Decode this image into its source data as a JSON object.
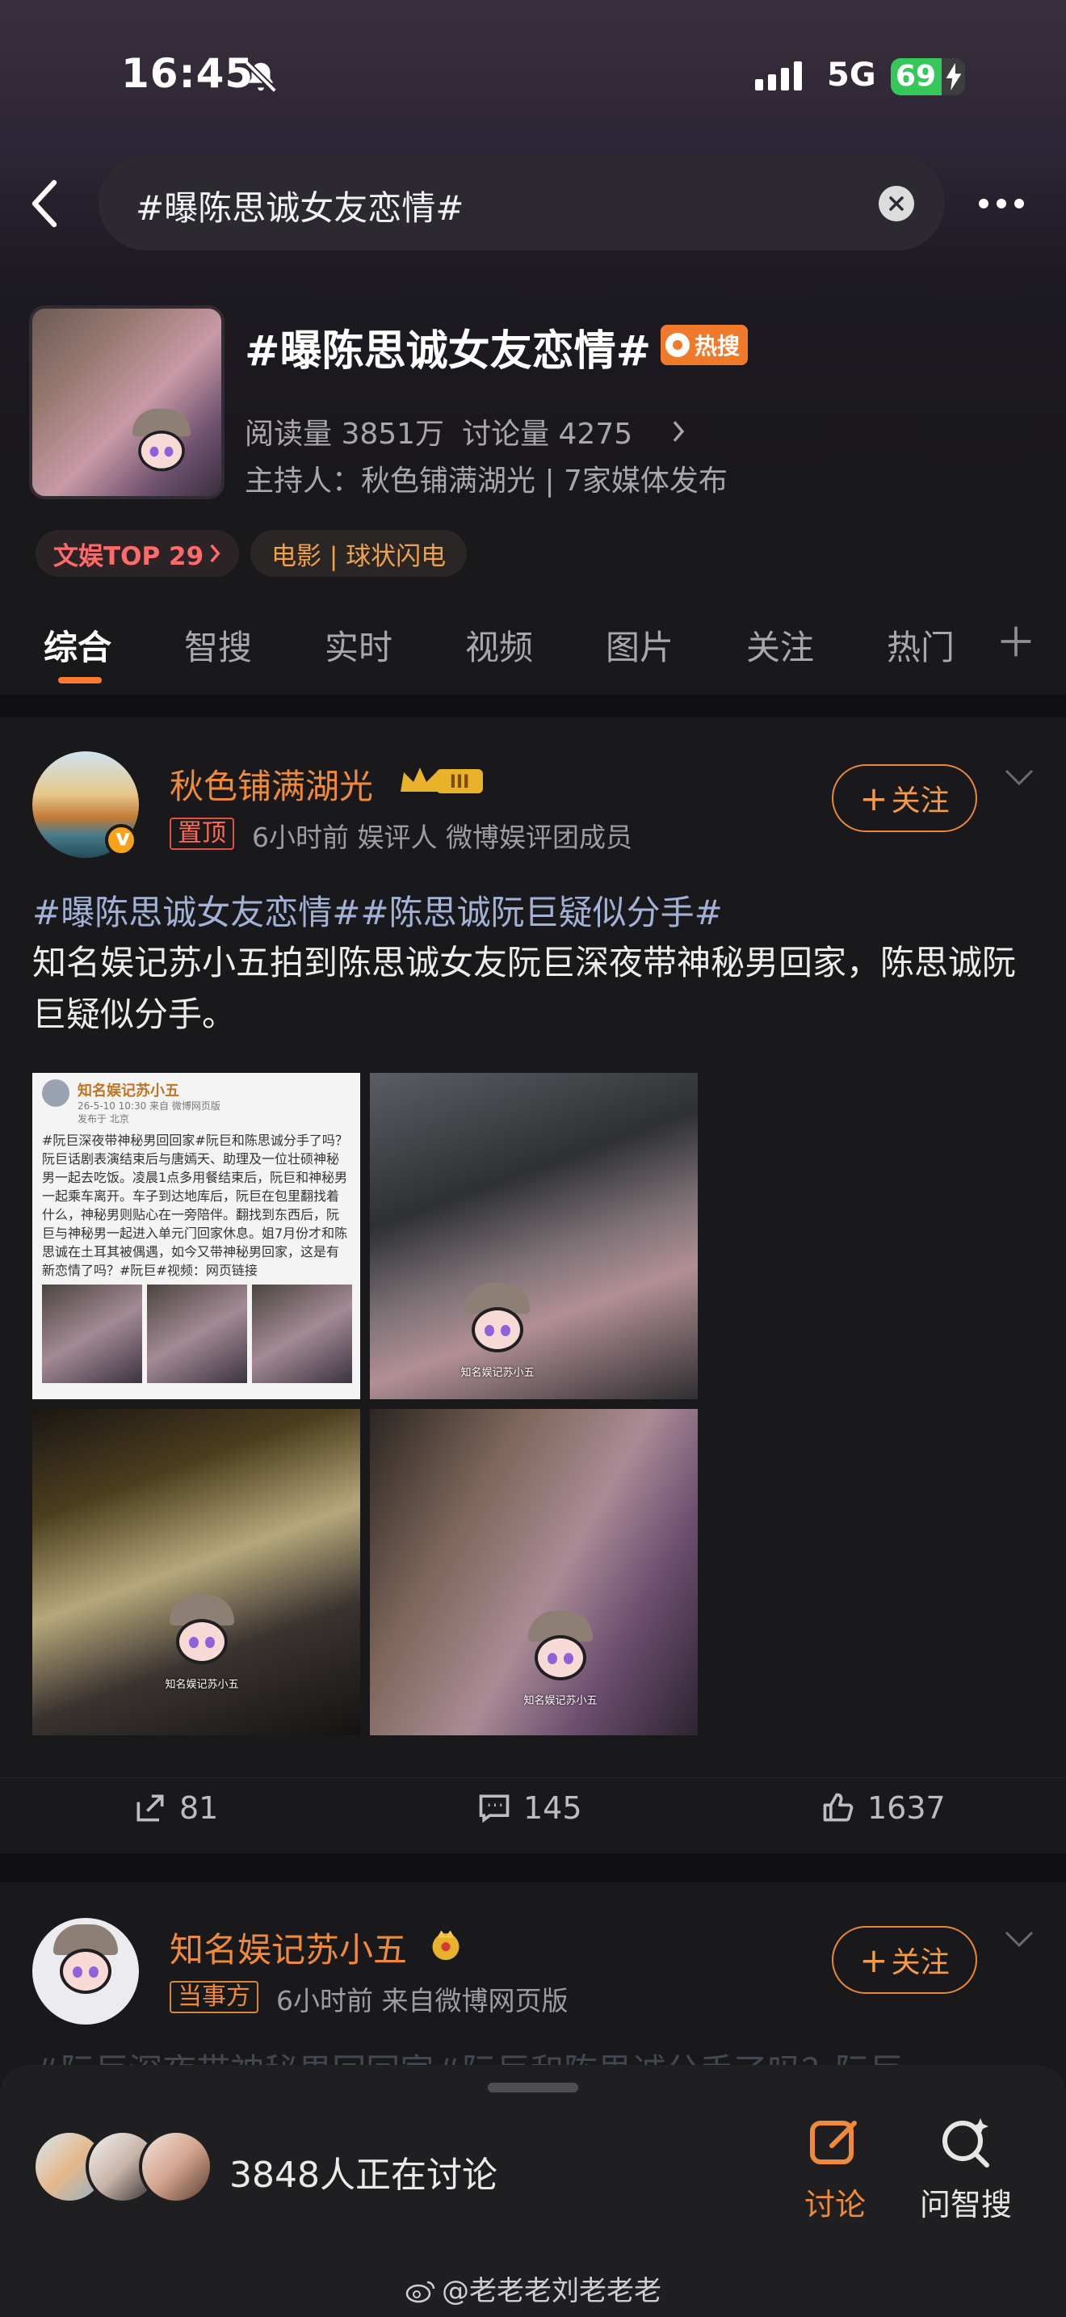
{
  "status": {
    "time": "16:45",
    "network": "5G",
    "battery": "69"
  },
  "search": {
    "query": "#曝陈思诚女友恋情#"
  },
  "topic": {
    "title": "#曝陈思诚女友恋情#",
    "hot_label": "热搜",
    "reads": "阅读量 3851万",
    "discussions": "讨论量 4275",
    "host": "主持人：秋色铺满湖光 | 7家媒体发布",
    "rank_chip": "文娱TOP 29",
    "movie_chip": "电影 | 球状闪电"
  },
  "tabs": [
    "综合",
    "智搜",
    "实时",
    "视频",
    "图片",
    "关注",
    "热门"
  ],
  "post1": {
    "user": "秋色铺满湖光",
    "level": "III",
    "pin_label": "置顶",
    "meta": "6小时前   娱评人   微博娱评团成员",
    "follow": "关注",
    "tags": "#曝陈思诚女友恋情##陈思诚阮巨疑似分手#",
    "body": "知名娱记苏小五拍到陈思诚女友阮巨深夜带神秘男回家，陈思诚阮巨疑似分手。",
    "image1": {
      "header": "知名娱记苏小五",
      "date": "26-5-10 10:30  来自 微博网页版",
      "location": "发布于 北京",
      "text": "#阮巨深夜带神秘男回回家#阮巨和陈思诚分手了吗？阮巨话剧表演结束后与唐嫣天、助理及一位壮硕神秘男一起去吃饭。凌晨1点多用餐结束后，阮巨和神秘男一起乘车离开。车子到达地库后，阮巨在包里翻找着什么，神秘男则贴心在一旁陪伴。翻找到东西后，阮巨与神秘男一起进入单元门回家休息。姐7月份才和陈思诚在土耳其被偶遇，如今又带神秘男回家，这是有新恋情了吗？#阮巨#视频：网页链接"
    },
    "mascot_caption": "知名娱记苏小五",
    "reposts": "81",
    "comments": "145",
    "likes": "1637"
  },
  "post2": {
    "user": "知名娱记苏小五",
    "role_label": "当事方",
    "meta": "6小时前  来自微博网页版",
    "follow": "关注",
    "preview": "#阮巨深夜带神秘男回回家#阮巨和陈思诚分手了吗？阮巨"
  },
  "bottom": {
    "discussing": "3848人正在讨论",
    "discuss_label": "讨论",
    "ask_label": "问智搜",
    "watermark": "@老老老刘老老老"
  },
  "colors": {
    "accent": "#f08a3a",
    "hot": "#f07a2a",
    "tag": "#a2b1d6",
    "pin": "#e0513c"
  }
}
